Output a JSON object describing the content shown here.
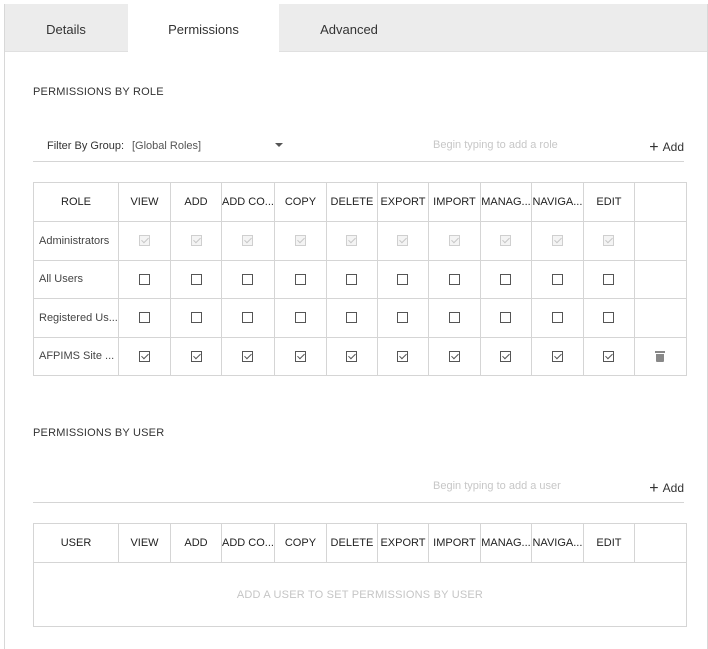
{
  "tabs": [
    {
      "label": "Details",
      "active": false
    },
    {
      "label": "Permissions",
      "active": true
    },
    {
      "label": "Advanced",
      "active": false
    }
  ],
  "role_section": {
    "title": "PERMISSIONS BY ROLE",
    "filter_label": "Filter By Group:",
    "filter_value": "[Global Roles]",
    "input_placeholder": "Begin typing to add a role",
    "add_label": "Add",
    "columns": [
      "ROLE",
      "VIEW",
      "ADD",
      "ADD CO...",
      "COPY",
      "DELETE",
      "EXPORT",
      "IMPORT",
      "MANAG...",
      "NAVIGA...",
      "EDIT"
    ],
    "rows": [
      {
        "name": "Administrators",
        "checked": true,
        "disabled": true,
        "deletable": false
      },
      {
        "name": "All Users",
        "checked": false,
        "disabled": false,
        "deletable": false
      },
      {
        "name": "Registered Us...",
        "checked": false,
        "disabled": false,
        "deletable": false
      },
      {
        "name": "AFPIMS Site ...",
        "checked": true,
        "disabled": false,
        "deletable": true
      }
    ]
  },
  "user_section": {
    "title": "PERMISSIONS BY USER",
    "input_placeholder": "Begin typing to add a user",
    "add_label": "Add",
    "columns": [
      "USER",
      "VIEW",
      "ADD",
      "ADD CO...",
      "COPY",
      "DELETE",
      "EXPORT",
      "IMPORT",
      "MANAG...",
      "NAVIGA...",
      "EDIT"
    ],
    "empty_message": "ADD A USER TO SET PERMISSIONS BY USER"
  },
  "icons": {
    "add": "plus-icon",
    "delete": "trash-icon",
    "dropdown": "caret-down-icon"
  }
}
